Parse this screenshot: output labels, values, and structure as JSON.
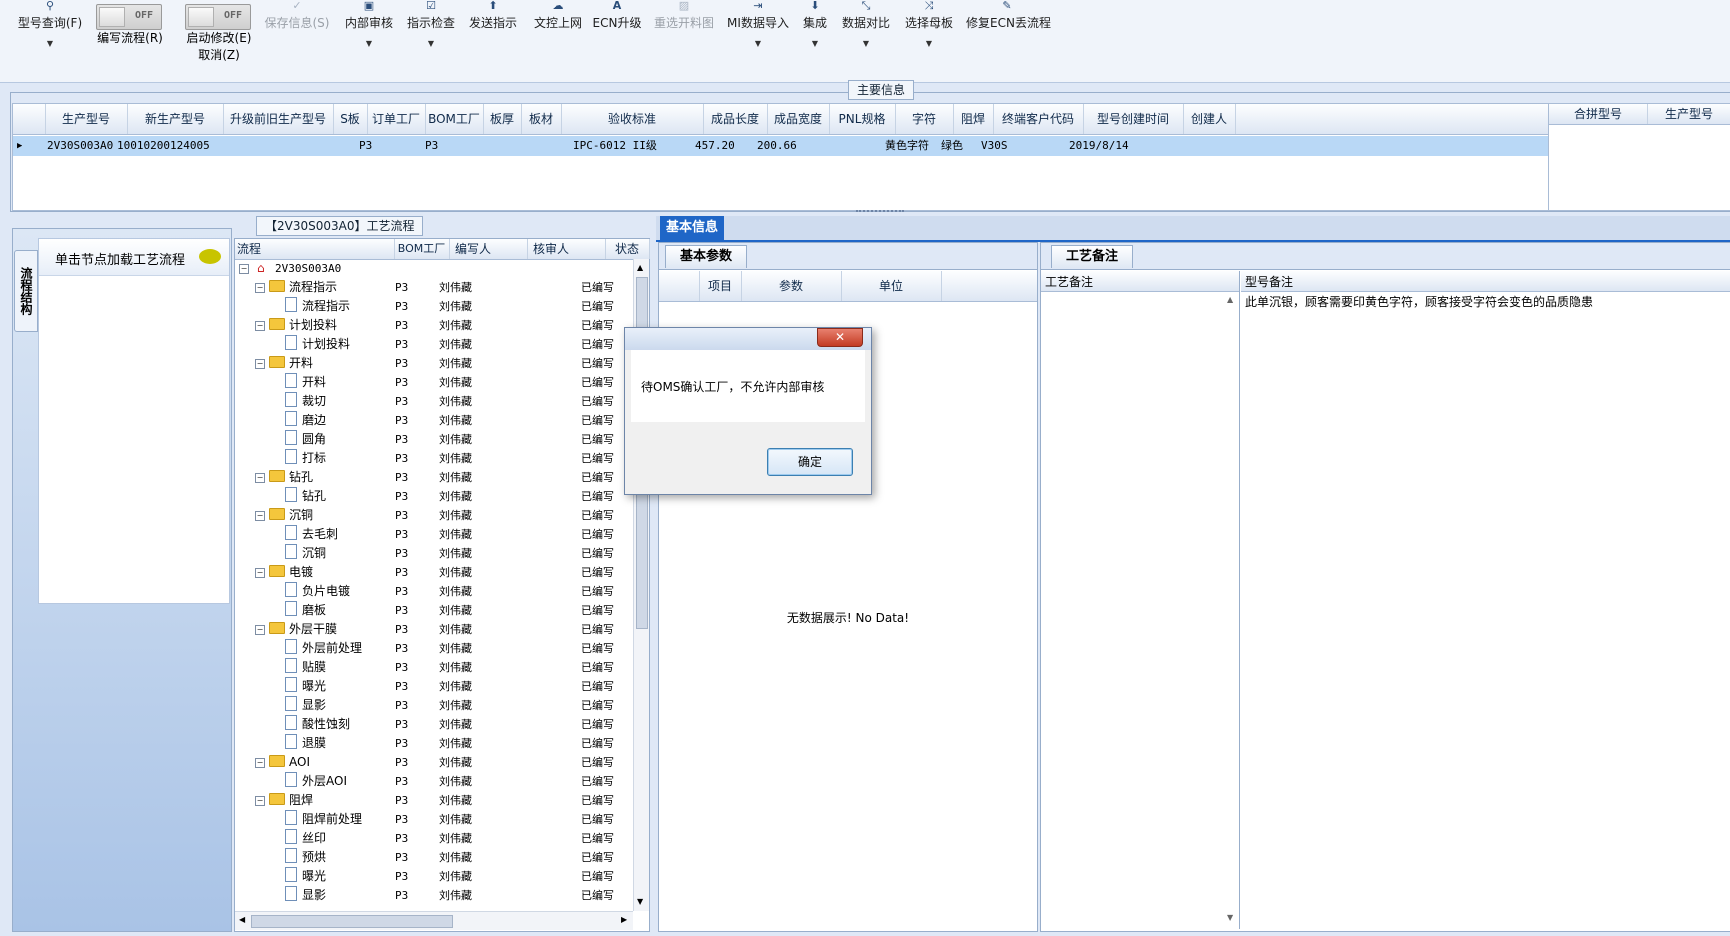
{
  "toolbar": {
    "items": [
      {
        "label": "型号查询(F)",
        "icon": "search-icon"
      },
      {
        "label": "保存信息(S)",
        "icon": "check-icon"
      },
      {
        "label": "内部审核",
        "icon": "printer-icon"
      },
      {
        "label": "指示检查",
        "icon": "checkbox-icon"
      },
      {
        "label": "发送指示",
        "icon": "upload-icon"
      },
      {
        "label": "文控上网",
        "icon": "cloud-upload-icon"
      },
      {
        "label": "ECN升级",
        "icon": "letter-a-icon"
      },
      {
        "label": "重选开料图",
        "icon": "image-icon"
      },
      {
        "label": "MI数据导入",
        "icon": "import-icon"
      },
      {
        "label": "集成",
        "icon": "download-icon"
      },
      {
        "label": "数据对比",
        "icon": "compare-icon"
      },
      {
        "label": "选择母板",
        "icon": "shuffle-icon"
      },
      {
        "label": "修复ECN丢流程",
        "icon": "wrench-icon"
      }
    ],
    "toggle_edit": {
      "state": "OFF",
      "label": "编写流程(R)"
    },
    "toggle_modify": {
      "state": "OFF",
      "label": "启动修改(E)",
      "sub_label": "取消(Z)"
    }
  },
  "main_info": {
    "title": "主要信息",
    "columns": [
      "生产型号",
      "新生产型号",
      "升级前旧生产型号",
      "S板",
      "订单工厂",
      "BOM工厂",
      "板厚",
      "板材",
      "验收标准",
      "成品长度",
      "成品宽度",
      "PNL规格",
      "字符",
      "阻焊",
      "终端客户代码",
      "型号创建时间",
      "创建人"
    ],
    "row": {
      "生产型号": "2V30S003A0",
      "新生产型号": "10010200124005",
      "订单工厂": "P3",
      "BOM工厂": "P3",
      "验收标准": "IPC-6012 II级",
      "成品长度": "457.20",
      "成品宽度": "200.66",
      "字符": "黄色字符",
      "阻焊": "绿色",
      "终端客户代码": "V30S",
      "型号创建时间": "2019/8/14"
    },
    "side_columns": [
      "合拼型号",
      "生产型号"
    ]
  },
  "sidebar": {
    "vertical_tab": "流程结构",
    "node_hint": "单击节点加载工艺流程"
  },
  "process": {
    "title": "【2V30S003A0】工艺流程",
    "columns": [
      "流程",
      "BOM工厂",
      "编写人",
      "核审人",
      "状态"
    ],
    "root": "2V30S003A0",
    "rows": [
      {
        "name": "流程指示",
        "type": "folder",
        "bom": "P3",
        "writer": "刘伟藏",
        "status": "已编写"
      },
      {
        "name": "流程指示",
        "type": "doc",
        "bom": "P3",
        "writer": "刘伟藏",
        "status": "已编写"
      },
      {
        "name": "计划投料",
        "type": "folder",
        "bom": "P3",
        "writer": "刘伟藏",
        "status": "已编写"
      },
      {
        "name": "计划投料",
        "type": "doc",
        "bom": "P3",
        "writer": "刘伟藏",
        "status": "已编写"
      },
      {
        "name": "开料",
        "type": "folder",
        "bom": "P3",
        "writer": "刘伟藏",
        "status": "已编写"
      },
      {
        "name": "开料",
        "type": "doc",
        "bom": "P3",
        "writer": "刘伟藏",
        "status": "已编写"
      },
      {
        "name": "裁切",
        "type": "doc",
        "bom": "P3",
        "writer": "刘伟藏",
        "status": "已编写"
      },
      {
        "name": "磨边",
        "type": "doc",
        "bom": "P3",
        "writer": "刘伟藏",
        "status": "已编写"
      },
      {
        "name": "圆角",
        "type": "doc",
        "bom": "P3",
        "writer": "刘伟藏",
        "status": "已编写"
      },
      {
        "name": "打标",
        "type": "doc",
        "bom": "P3",
        "writer": "刘伟藏",
        "status": "已编写"
      },
      {
        "name": "钻孔",
        "type": "folder",
        "bom": "P3",
        "writer": "刘伟藏",
        "status": "已编写"
      },
      {
        "name": "钻孔",
        "type": "doc",
        "bom": "P3",
        "writer": "刘伟藏",
        "status": "已编写"
      },
      {
        "name": "沉铜",
        "type": "folder",
        "bom": "P3",
        "writer": "刘伟藏",
        "status": "已编写"
      },
      {
        "name": "去毛刺",
        "type": "doc",
        "bom": "P3",
        "writer": "刘伟藏",
        "status": "已编写"
      },
      {
        "name": "沉铜",
        "type": "doc",
        "bom": "P3",
        "writer": "刘伟藏",
        "status": "已编写"
      },
      {
        "name": "电镀",
        "type": "folder",
        "bom": "P3",
        "writer": "刘伟藏",
        "status": "已编写"
      },
      {
        "name": "负片电镀",
        "type": "doc",
        "bom": "P3",
        "writer": "刘伟藏",
        "status": "已编写"
      },
      {
        "name": "磨板",
        "type": "doc",
        "bom": "P3",
        "writer": "刘伟藏",
        "status": "已编写"
      },
      {
        "name": "外层干膜",
        "type": "folder",
        "bom": "P3",
        "writer": "刘伟藏",
        "status": "已编写"
      },
      {
        "name": "外层前处理",
        "type": "doc",
        "bom": "P3",
        "writer": "刘伟藏",
        "status": "已编写"
      },
      {
        "name": "贴膜",
        "type": "doc",
        "bom": "P3",
        "writer": "刘伟藏",
        "status": "已编写"
      },
      {
        "name": "曝光",
        "type": "doc",
        "bom": "P3",
        "writer": "刘伟藏",
        "status": "已编写"
      },
      {
        "name": "显影",
        "type": "doc",
        "bom": "P3",
        "writer": "刘伟藏",
        "status": "已编写"
      },
      {
        "name": "酸性蚀刻",
        "type": "doc",
        "bom": "P3",
        "writer": "刘伟藏",
        "status": "已编写"
      },
      {
        "name": "退膜",
        "type": "doc",
        "bom": "P3",
        "writer": "刘伟藏",
        "status": "已编写"
      },
      {
        "name": "AOI",
        "type": "folder",
        "bom": "P3",
        "writer": "刘伟藏",
        "status": "已编写"
      },
      {
        "name": "外层AOI",
        "type": "doc",
        "bom": "P3",
        "writer": "刘伟藏",
        "status": "已编写"
      },
      {
        "name": "阻焊",
        "type": "folder",
        "bom": "P3",
        "writer": "刘伟藏",
        "status": "已编写"
      },
      {
        "name": "阻焊前处理",
        "type": "doc",
        "bom": "P3",
        "writer": "刘伟藏",
        "status": "已编写"
      },
      {
        "name": "丝印",
        "type": "doc",
        "bom": "P3",
        "writer": "刘伟藏",
        "status": "已编写"
      },
      {
        "name": "预烘",
        "type": "doc",
        "bom": "P3",
        "writer": "刘伟藏",
        "status": "已编写"
      },
      {
        "name": "曝光",
        "type": "doc",
        "bom": "P3",
        "writer": "刘伟藏",
        "status": "已编写"
      },
      {
        "name": "显影",
        "type": "doc",
        "bom": "P3",
        "writer": "刘伟藏",
        "status": "已编写"
      }
    ]
  },
  "basic_info": {
    "tab": "基本信息",
    "subtab": "基本参数",
    "columns": [
      "项目",
      "参数",
      "单位"
    ],
    "empty_text": "无数据展示! No Data!"
  },
  "craft_note": {
    "tab": "工艺备注",
    "col_left": "工艺备注",
    "col_right": "型号备注",
    "note": "此单沉银，顾客需要印黄色字符，顾客接受字符会变色的品质隐患"
  },
  "dialog": {
    "message": "待OMS确认工厂，不允许内部审核",
    "ok": "确定"
  },
  "colors": {
    "accent": "#1f66c7",
    "selection": "#b9d8f6",
    "frame": "#98aecb"
  }
}
